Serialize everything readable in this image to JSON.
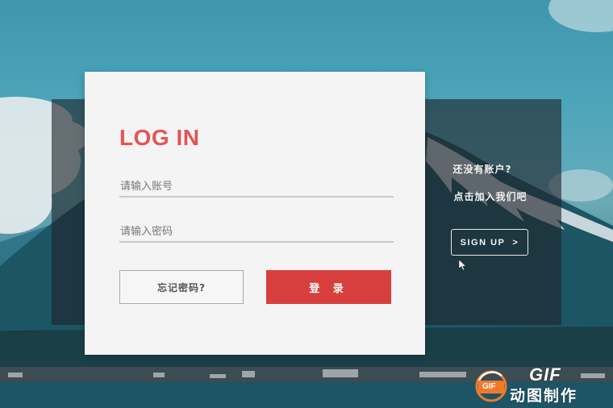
{
  "login": {
    "title": "LOG IN",
    "account_placeholder": "请输入账号",
    "password_placeholder": "请输入密码",
    "forgot_label": "忘记密码?",
    "login_label": "登 录"
  },
  "signup": {
    "line1": "还没有账户?",
    "line2": "点击加入我们吧",
    "button_label": "SIGN UP",
    "button_chevron": ">"
  },
  "watermark": {
    "gif": "GIF",
    "text": "动图制作",
    "logo_label": "GIF"
  },
  "colors": {
    "accent": "#e45454",
    "login_button": "#d93e3e",
    "card_bg": "#f4f4f4",
    "overlay": "rgba(30,36,40,0.62)",
    "watermark_logo": "#f07a2c"
  },
  "icons": {
    "signup_arrow": "chevron-right-icon",
    "cursor": "mouse-pointer-icon",
    "watermark_logo": "gif-logo-icon"
  }
}
